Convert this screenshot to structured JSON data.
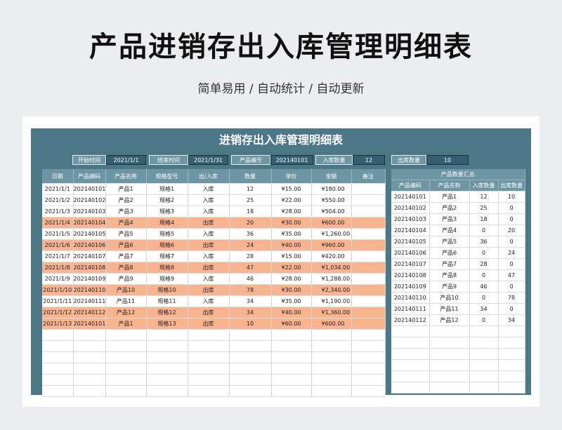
{
  "page": {
    "title": "产品进销存出入库管理明细表",
    "subtitle": "简单易用 / 自动统计 / 自动更新"
  },
  "sheet": {
    "title": "进销存出入库管理明细表",
    "controls": {
      "start_label": "开始时间",
      "start_value": "2021/1/1",
      "end_label": "结束时间",
      "end_value": "2021/1/31",
      "code_label": "产品编号",
      "code_value": "202140101",
      "in_qty_label": "入库数量",
      "in_qty_value": "12",
      "out_qty_label": "出库数量",
      "out_qty_value": "10"
    },
    "main_headers": [
      "日期",
      "产品编码",
      "产品名称",
      "规格型号",
      "出/入库",
      "数量",
      "单价",
      "金额",
      "备注"
    ],
    "main_rows": [
      {
        "date": "2021/1/1",
        "code": "202140101",
        "name": "产品1",
        "spec": "规格1",
        "dir": "入库",
        "qty": "12",
        "price": "¥15.00",
        "amount": "¥180.00",
        "note": "",
        "out": false
      },
      {
        "date": "2021/1/2",
        "code": "202140102",
        "name": "产品2",
        "spec": "规格2",
        "dir": "入库",
        "qty": "25",
        "price": "¥22.00",
        "amount": "¥550.00",
        "note": "",
        "out": false
      },
      {
        "date": "2021/1/3",
        "code": "202140103",
        "name": "产品3",
        "spec": "规格3",
        "dir": "入库",
        "qty": "18",
        "price": "¥28.00",
        "amount": "¥504.00",
        "note": "",
        "out": false
      },
      {
        "date": "2021/1/4",
        "code": "202140104",
        "name": "产品4",
        "spec": "规格4",
        "dir": "出库",
        "qty": "20",
        "price": "¥30.00",
        "amount": "¥600.00",
        "note": "",
        "out": true
      },
      {
        "date": "2021/1/5",
        "code": "202140105",
        "name": "产品5",
        "spec": "规格5",
        "dir": "入库",
        "qty": "36",
        "price": "¥35.00",
        "amount": "¥1,260.00",
        "note": "",
        "out": false
      },
      {
        "date": "2021/1/6",
        "code": "202140106",
        "name": "产品6",
        "spec": "规格6",
        "dir": "出库",
        "qty": "24",
        "price": "¥40.00",
        "amount": "¥960.00",
        "note": "",
        "out": true
      },
      {
        "date": "2021/1/7",
        "code": "202140107",
        "name": "产品7",
        "spec": "规格7",
        "dir": "入库",
        "qty": "28",
        "price": "¥15.00",
        "amount": "¥420.00",
        "note": "",
        "out": false
      },
      {
        "date": "2021/1/8",
        "code": "202140108",
        "name": "产品8",
        "spec": "规格8",
        "dir": "出库",
        "qty": "47",
        "price": "¥22.00",
        "amount": "¥1,034.00",
        "note": "",
        "out": true
      },
      {
        "date": "2021/1/9",
        "code": "202140109",
        "name": "产品9",
        "spec": "规格9",
        "dir": "入库",
        "qty": "46",
        "price": "¥28.00",
        "amount": "¥1,288.00",
        "note": "",
        "out": false
      },
      {
        "date": "2021/1/10",
        "code": "202140110",
        "name": "产品10",
        "spec": "规格10",
        "dir": "出库",
        "qty": "78",
        "price": "¥30.00",
        "amount": "¥2,340.00",
        "note": "",
        "out": true
      },
      {
        "date": "2021/1/11",
        "code": "202140111",
        "name": "产品11",
        "spec": "规格11",
        "dir": "入库",
        "qty": "34",
        "price": "¥35.00",
        "amount": "¥1,190.00",
        "note": "",
        "out": false
      },
      {
        "date": "2021/1/12",
        "code": "202140112",
        "name": "产品12",
        "spec": "规格12",
        "dir": "出库",
        "qty": "34",
        "price": "¥40.00",
        "amount": "¥1,360.00",
        "note": "",
        "out": true
      },
      {
        "date": "2021/1/13",
        "code": "202140101",
        "name": "产品1",
        "spec": "规格13",
        "dir": "出库",
        "qty": "10",
        "price": "¥60.00",
        "amount": "¥600.00",
        "note": "",
        "out": true
      }
    ],
    "summary": {
      "group_header": "产品数量汇总",
      "headers": [
        "产品编码",
        "产品名称",
        "入库数量",
        "出库数量"
      ],
      "rows": [
        [
          "202140101",
          "产品1",
          "12",
          "10"
        ],
        [
          "202140102",
          "产品2",
          "25",
          "0"
        ],
        [
          "202140103",
          "产品3",
          "18",
          "0"
        ],
        [
          "202140104",
          "产品4",
          "0",
          "20"
        ],
        [
          "202140105",
          "产品5",
          "36",
          "0"
        ],
        [
          "202140106",
          "产品6",
          "0",
          "24"
        ],
        [
          "202140107",
          "产品7",
          "28",
          "0"
        ],
        [
          "202140108",
          "产品8",
          "0",
          "47"
        ],
        [
          "202140109",
          "产品9",
          "46",
          "0"
        ],
        [
          "202140110",
          "产品10",
          "0",
          "78"
        ],
        [
          "202140111",
          "产品11",
          "34",
          "0"
        ],
        [
          "202140112",
          "产品12",
          "0",
          "34"
        ]
      ]
    },
    "colors": {
      "panel": "#4c7787",
      "header": "#6d95a3",
      "outbound_row": "#f9b38d"
    }
  }
}
